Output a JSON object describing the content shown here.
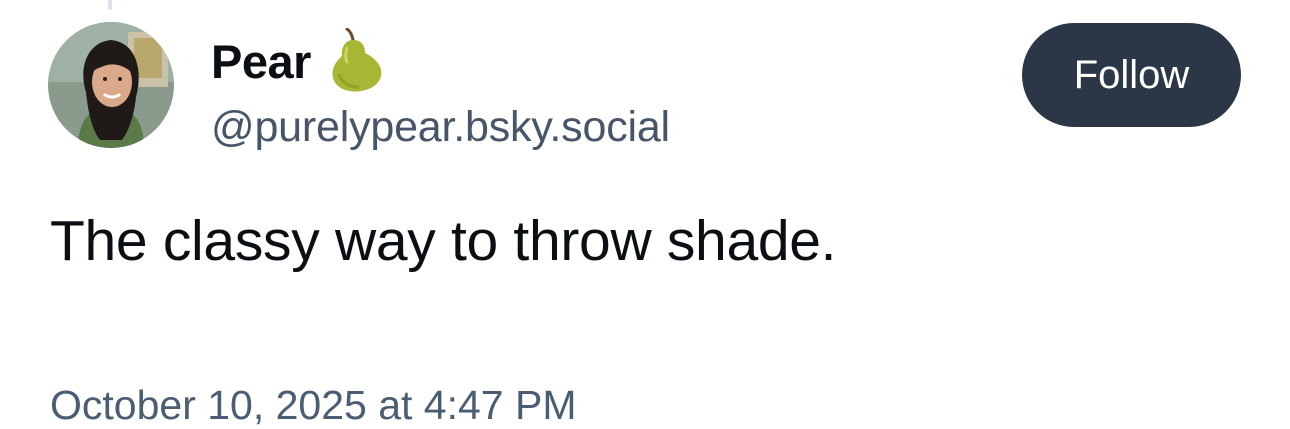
{
  "post": {
    "author": {
      "display_name": "Pear",
      "handle": "@purelypear.bsky.social",
      "name_emoji_icon": "pear-icon",
      "avatar_icon": "avatar-photo"
    },
    "follow_label": "Follow",
    "text": "The classy way to throw shade.",
    "timestamp": "October 10, 2025 at 4:47 PM"
  },
  "colors": {
    "follow_button_bg": "#2b3746",
    "handle_text": "#475569",
    "timestamp_text": "#4b5d72",
    "primary_text": "#0b0f14"
  }
}
